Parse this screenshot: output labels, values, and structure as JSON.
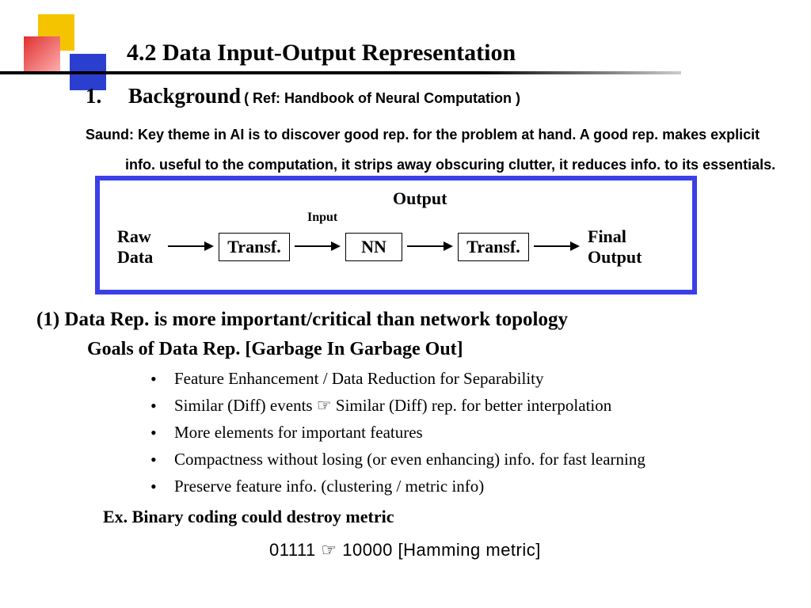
{
  "title": "4.2  Data Input-Output Representation",
  "section1": {
    "num": "1.",
    "title": "Background",
    "ref": "( Ref: Handbook of Neural Computation )"
  },
  "saund": {
    "line1": "Saund: Key theme in AI is to discover good rep. for the problem at hand. A good rep. makes explicit",
    "line2": "info. useful to the computation, it strips away obscuring clutter, it reduces info. to its essentials."
  },
  "diagram": {
    "raw": "Raw\nData",
    "transf1": "Transf.",
    "input_label": "Input",
    "nn": "NN",
    "output_label": "Output",
    "transf2": "Transf.",
    "final": "Final\nOutput"
  },
  "point1": "(1)  Data Rep. is  more important/critical than network topology",
  "goals": "Goals of Data Rep. [Garbage In Garbage Out]",
  "bullets": [
    "Feature Enhancement / Data Reduction for Separability",
    "Similar (Diff) events  ☞ Similar (Diff) rep. for better interpolation",
    "More elements for important features",
    "Compactness without losing (or even enhancing) info. for fast learning",
    "Preserve feature info. (clustering / metric  info)"
  ],
  "ex": "Ex. Binary coding could destroy metric",
  "hamming": "01111 ☞ 10000 [Hamming metric]"
}
